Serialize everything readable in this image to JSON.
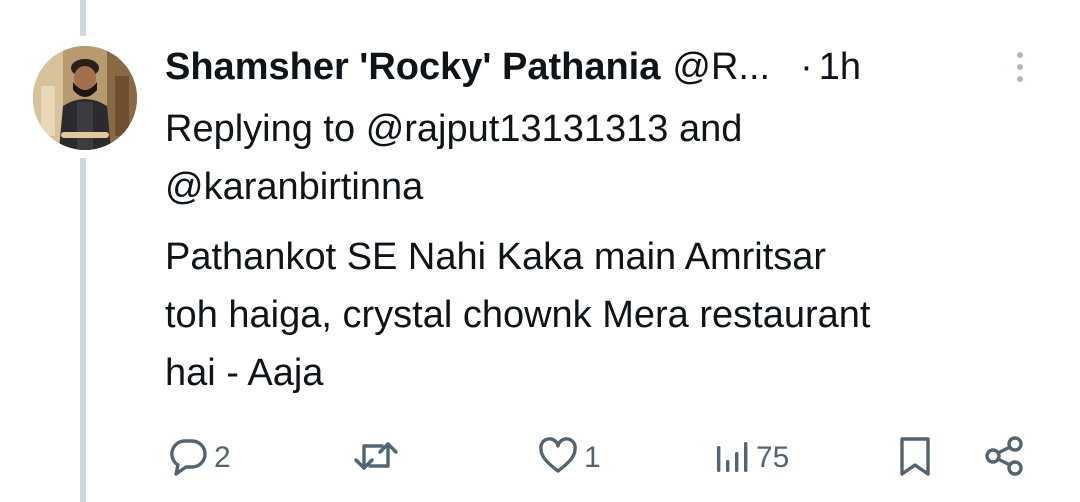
{
  "tweet": {
    "display_name": "Shamsher 'Rocky' Pathania",
    "handle": "@R...",
    "time_separator": "·",
    "time": "1h",
    "reply_prefix": "Replying to",
    "reply_user_1": "@rajput13131313",
    "reply_and": "and",
    "reply_user_2": "@karanbirtinna",
    "text_line_1": "Pathankot SE Nahi Kaka main Amritsar",
    "text_line_2": "toh haiga, crystal chownk Mera restaurant",
    "text_line_3": "hai - Aaja"
  },
  "actions": {
    "reply_count": "2",
    "retweet_count": "",
    "like_count": "1",
    "views_count": "75"
  },
  "icons": {
    "reply": "speech-bubble-icon",
    "retweet": "retweet-arrows-icon",
    "like": "heart-icon",
    "views": "bar-chart-icon",
    "bookmark": "bookmark-icon",
    "share": "share-icon",
    "more": "more-vertical-icon"
  },
  "colors": {
    "text_primary": "#0f1419",
    "text_secondary": "#536471",
    "thread_line": "#cfd9de"
  }
}
